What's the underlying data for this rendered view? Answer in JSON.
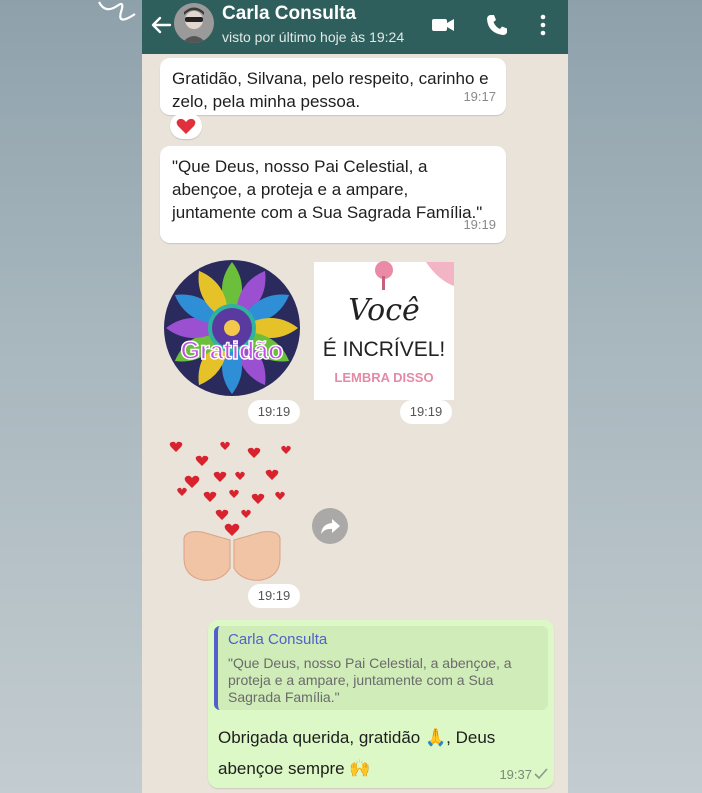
{
  "header": {
    "contact_name": "Carla Consulta",
    "status": "visto por último hoje às 19:24"
  },
  "messages": {
    "m1": {
      "text": "Gratidão, Silvana, pelo respeito, carinho e zelo, pela minha pessoa.",
      "time": "19:17",
      "reaction": "red-heart"
    },
    "m2": {
      "text": "\"Que Deus, nosso Pai Celestial,  a abenҫoe,  a proteja e a ampare, juntamente com a Sua Sagrada Família.\"",
      "time": "19:19"
    },
    "sticker_gratidao": {
      "word": "Gratidão",
      "time": "19:19"
    },
    "sticker_voce": {
      "line1": "Você",
      "line2": "É INCRÍVEL!",
      "line3": "LEMBRA DISSO",
      "time": "19:19"
    },
    "sticker_hearts": {
      "time": "19:19"
    }
  },
  "reply": {
    "quoted_name": "Carla Consulta",
    "quoted_text": "\"Que Deus, nosso Pai Celestial,  a abenҫoe,  a proteja e a ampare, juntamente com a Sua Sagrada Família.\"",
    "text": "Obrigada querida,  gratidão 🙏, Deus abençoe sempre 🙌",
    "time": "19:37"
  },
  "colors": {
    "header": "#2f5f5c",
    "chat_bg": "#e9e3da",
    "outgoing": "#dcf8c6",
    "quote_accent": "#5161c9"
  },
  "icons": [
    "back-arrow-icon",
    "video-call-icon",
    "phone-icon",
    "more-vert-icon",
    "forward-icon",
    "read-check-icon",
    "red-heart-icon"
  ]
}
